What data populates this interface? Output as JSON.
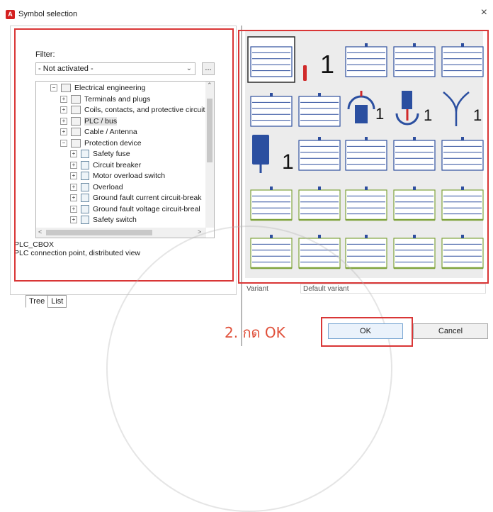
{
  "window": {
    "title": "Symbol selection",
    "close_glyph": "×"
  },
  "filter": {
    "label": "Filter:",
    "value": "- Not activated -",
    "more_button": "..."
  },
  "tree": {
    "items": [
      {
        "label": "Electrical engineering",
        "expander": "⊟",
        "icon": "folder-icon"
      },
      {
        "label": "Terminals and plugs",
        "expander": "⊞",
        "icon": "folder-icon"
      },
      {
        "label": "Coils, contacts, and protective circuit",
        "expander": "⊞",
        "icon": "folder-icon"
      },
      {
        "label": "PLC / bus",
        "expander": "⊞",
        "icon": "folder-icon",
        "selected": true
      },
      {
        "label": "Cable / Antenna",
        "expander": "⊞",
        "icon": "folder-icon"
      },
      {
        "label": "Protection device",
        "expander": "⊟",
        "icon": "folder-icon"
      },
      {
        "label": "Safety fuse",
        "expander": "⊞",
        "icon": "function-icon"
      },
      {
        "label": "Circuit breaker",
        "expander": "⊞",
        "icon": "function-icon"
      },
      {
        "label": "Motor overload switch",
        "expander": "⊞",
        "icon": "function-icon"
      },
      {
        "label": "Overload",
        "expander": "⊞",
        "icon": "function-icon"
      },
      {
        "label": "Ground fault current circuit-break",
        "expander": "⊞",
        "icon": "function-icon"
      },
      {
        "label": "Ground fault voltage circuit-breal",
        "expander": "⊞",
        "icon": "function-icon"
      },
      {
        "label": "Safety switch",
        "expander": "⊞",
        "icon": "function-icon"
      }
    ]
  },
  "description": {
    "name": "PLC_CBOX",
    "text": "PLC connection point, distributed view"
  },
  "tabs": [
    "Tree",
    "List"
  ],
  "gallery": {
    "variant_label": "Variant",
    "variant_value": "Default variant",
    "number_labels": {
      "row1": "1",
      "row2a": "1",
      "row2b": "1",
      "row2c": "1",
      "row3": "1"
    },
    "colors": {
      "symbol_blue": "#2f4f9e",
      "symbol_green": "#7fa33c",
      "highlight_red": "#d93636",
      "block_blue": "#2b4fa0"
    }
  },
  "annotation": "2. กด OK",
  "buttons": {
    "ok": "OK",
    "cancel": "Cancel"
  }
}
